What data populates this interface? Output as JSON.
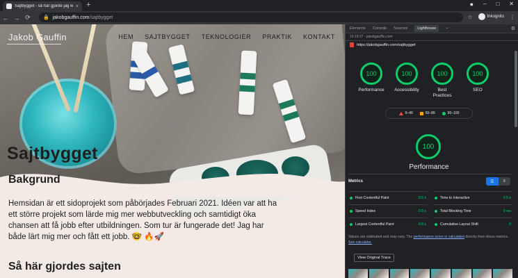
{
  "browser": {
    "tab_title": "Sajtbygget - så här gjorde jag w",
    "tab_close": "×",
    "new_tab": "+",
    "window_controls": {
      "minimize": "–",
      "maximize": "□",
      "close": "✕",
      "profile": "●"
    },
    "nav": {
      "back": "←",
      "forward": "→",
      "reload": "⟳"
    },
    "url_host": "jakobgauffin.com",
    "url_path": "/sajtbygget",
    "lock": "🔒",
    "star": "☆",
    "incognito_label": "Inkognito",
    "menu": "⋮"
  },
  "site": {
    "logo": "Jakob Gauffin",
    "menu": [
      "HEM",
      "SAJTBYGGET",
      "TEKNOLOGIER",
      "PRAKTIK",
      "KONTAKT"
    ],
    "title": "Sajtbygget",
    "section1_heading": "Bakgrund",
    "paragraph": "Hemsidan är ett sidoprojekt som påbörjades Februari 2021. Idéen var att ha ett större projekt som lärde mig mer webbutveckling och samtidigt öka chansen att få jobb efter utbildningen. Som tur är fungerade det! Jag har både lärt mig mer och fått ett jobb. 🤓 🔥🚀",
    "section2_heading": "Så här gjordes sajten"
  },
  "devtools": {
    "tabs": [
      "Elements",
      "Console",
      "Sources",
      "Lighthouse"
    ],
    "more_tabs": "»",
    "settings": "⚙",
    "close": "✕",
    "report_label": "19:19:37 - jakobgauffin.com",
    "report_url": "https://jakobgauffin.com/sajtbygget",
    "scores": [
      {
        "value": "100",
        "label": "Performance"
      },
      {
        "value": "100",
        "label": "Accessibility"
      },
      {
        "value": "100",
        "label": "Best Practices"
      },
      {
        "value": "100",
        "label": "SEO"
      }
    ],
    "legend": [
      "0–49",
      "50–89",
      "90–100"
    ],
    "performance_score": "100",
    "performance_label": "Performance",
    "metrics_title": "Metrics",
    "metrics": [
      {
        "name": "First Contentful Paint",
        "value": "0.5 s"
      },
      {
        "name": "Time to Interactive",
        "value": "0.5 s"
      },
      {
        "name": "Speed Index",
        "value": "0.5 s"
      },
      {
        "name": "Total Blocking Time",
        "value": "0 ms"
      },
      {
        "name": "Largest Contentful Paint",
        "value": "0.6 s"
      },
      {
        "name": "Cumulative Layout Shift",
        "value": "0"
      }
    ],
    "note_prefix": "Values are estimated and may vary. The ",
    "note_link1": "performance score is calculated",
    "note_mid": " directly from these metrics. ",
    "note_link2": "See calculator.",
    "trace_button": "View Original Trace"
  }
}
